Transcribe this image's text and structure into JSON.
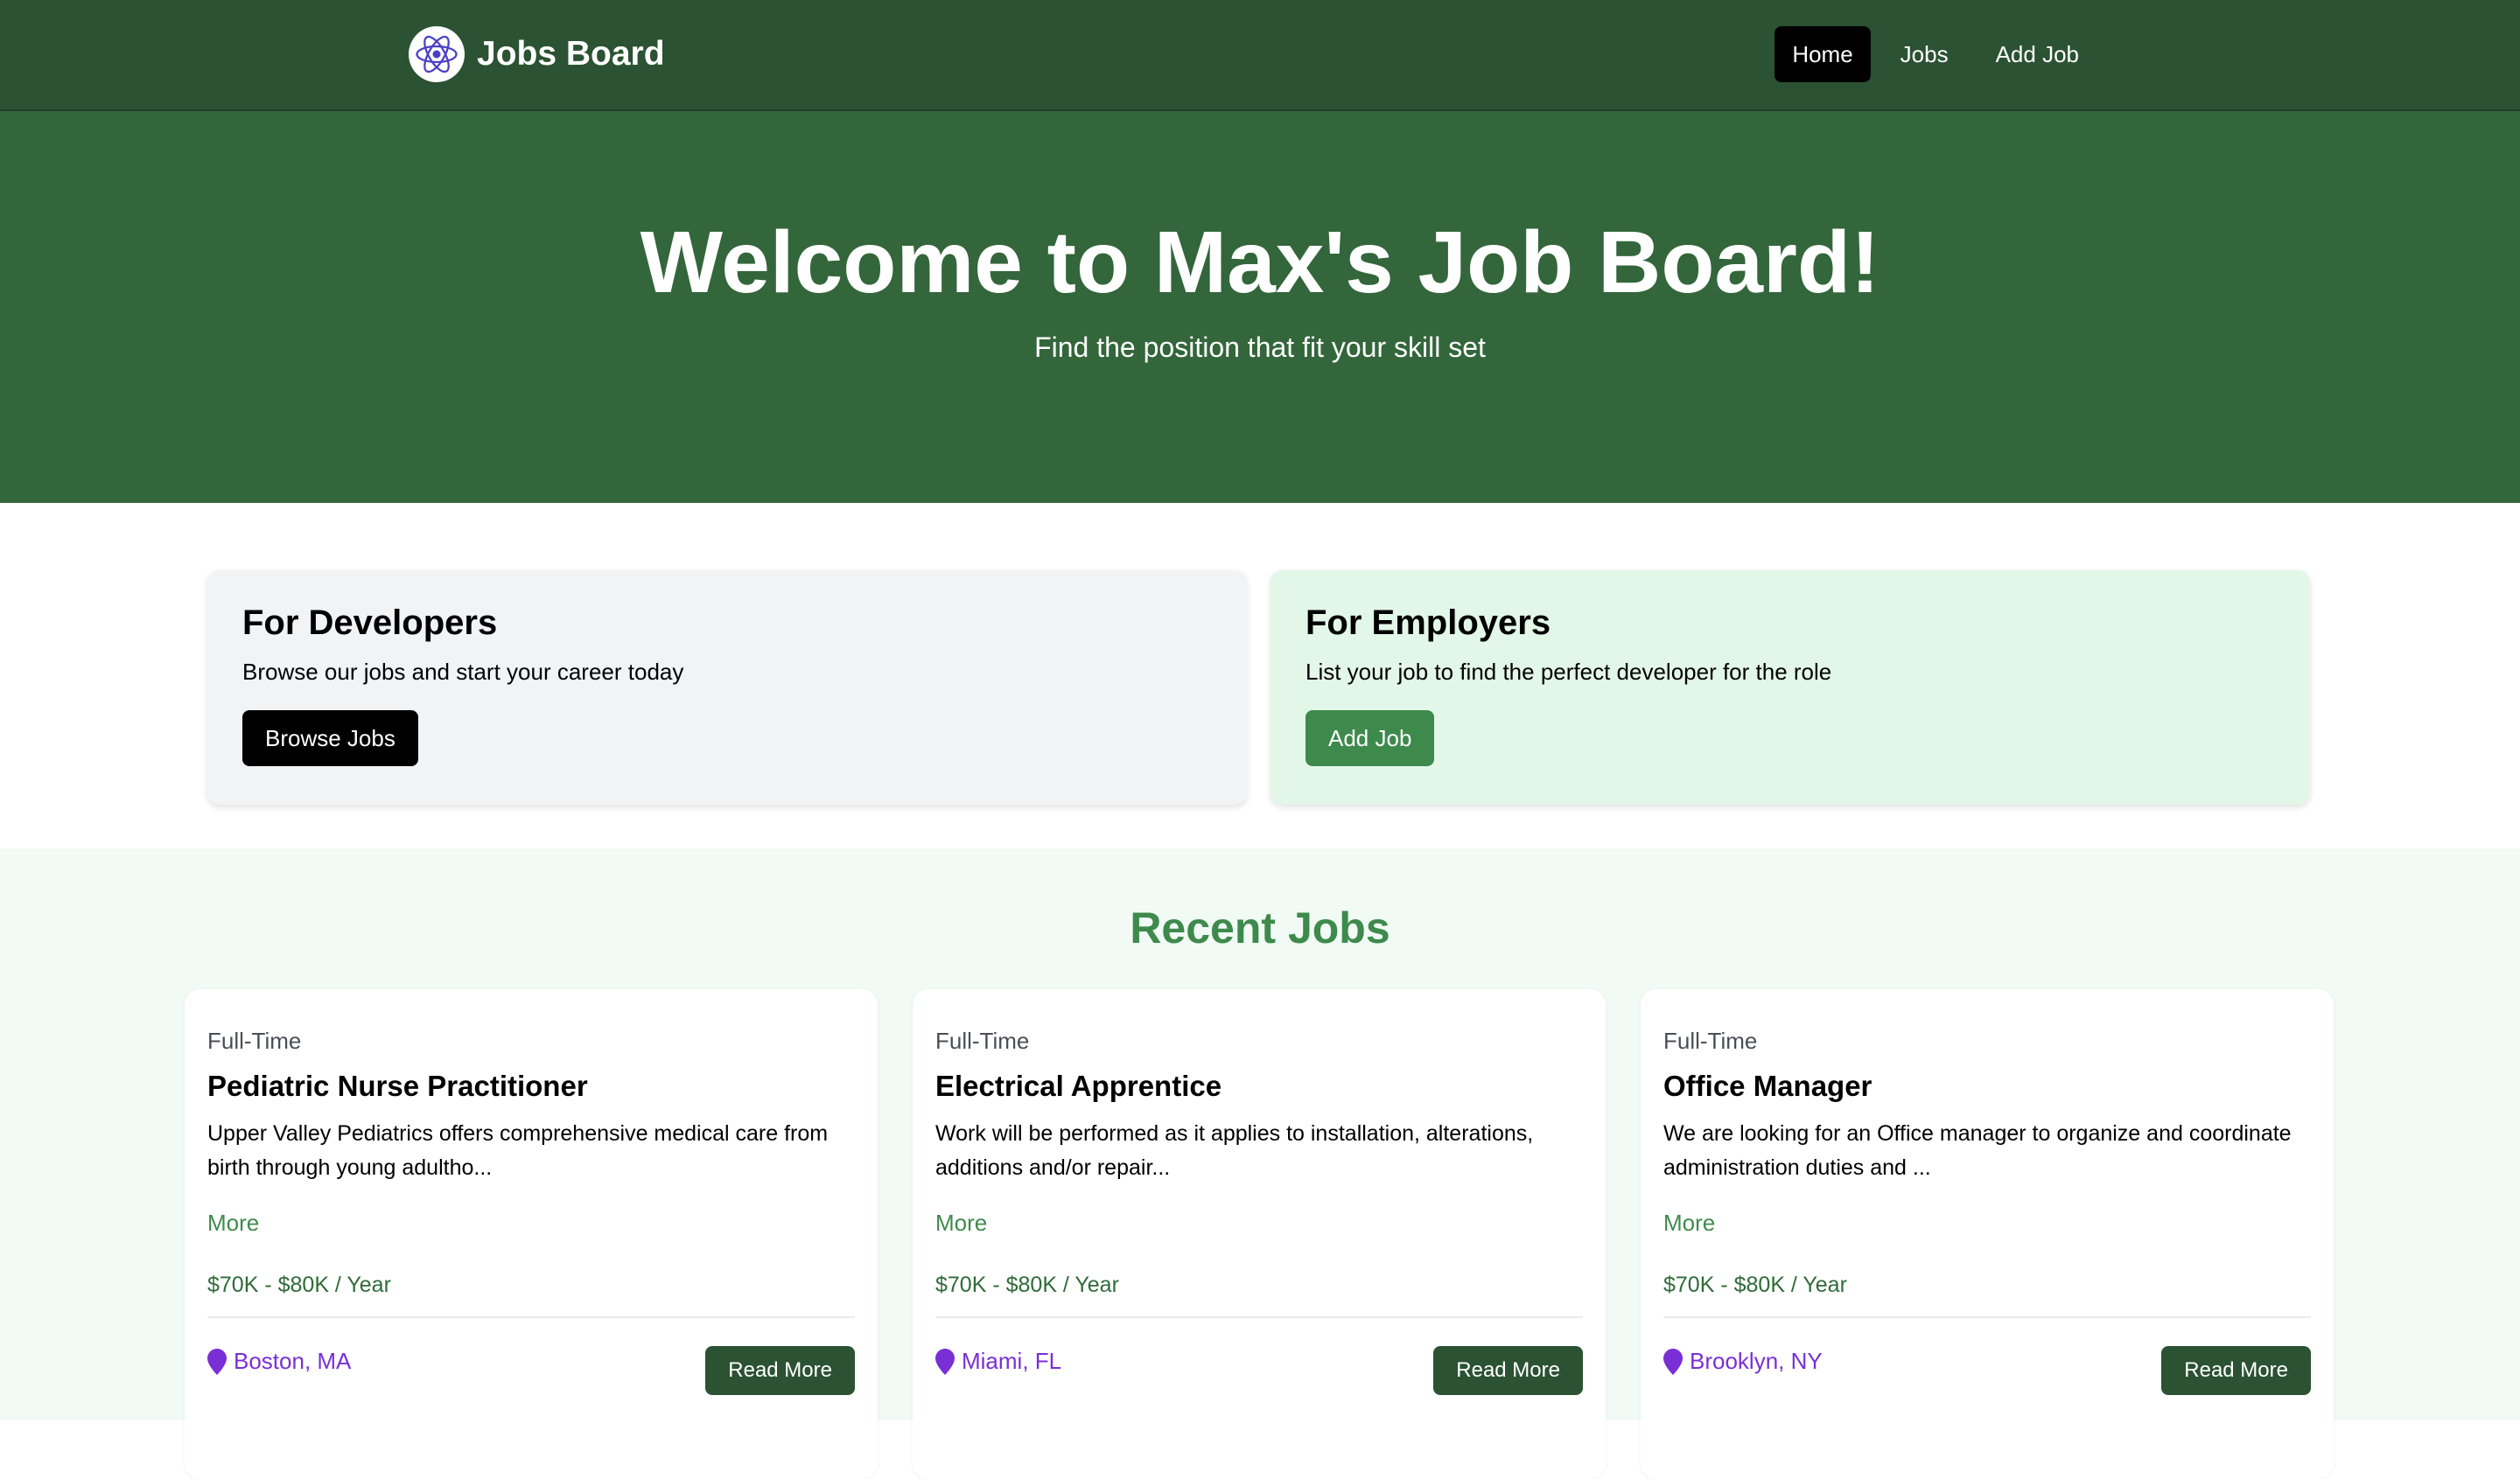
{
  "nav": {
    "brand": "Jobs Board",
    "links": [
      "Home",
      "Jobs",
      "Add Job"
    ]
  },
  "hero": {
    "title": "Welcome to Max's Job Board!",
    "subtitle": "Find the position that fit your skill set"
  },
  "developers": {
    "title": "For Developers",
    "text": "Browse our jobs and start your career today",
    "button": "Browse Jobs"
  },
  "employers": {
    "title": "For Employers",
    "text": "List your job to find the perfect developer for the role",
    "button": "Add Job"
  },
  "recent": {
    "heading": "Recent Jobs",
    "jobs": [
      {
        "type": "Full-Time",
        "title": "Pediatric Nurse Practitioner",
        "description": "Upper Valley Pediatrics offers comprehensive medical care from birth through young adultho...",
        "more": "More",
        "salary": "$70K - $80K / Year",
        "location": "Boston, MA",
        "button": "Read More"
      },
      {
        "type": "Full-Time",
        "title": "Electrical Apprentice",
        "description": "Work will be performed as it applies to installation, alterations, additions and/or repair...",
        "more": "More",
        "salary": "$70K - $80K / Year",
        "location": "Miami, FL",
        "button": "Read More"
      },
      {
        "type": "Full-Time",
        "title": "Office Manager",
        "description": "We are looking for an Office manager to organize and coordinate administration duties and ...",
        "more": "More",
        "salary": "$70K - $80K / Year",
        "location": "Brooklyn, NY",
        "button": "Read More"
      }
    ]
  },
  "colors": {
    "nav_bg": "#2b5233",
    "hero_bg": "#33663b",
    "accent_green": "#3e8a4c",
    "location_purple": "#7a2fd6"
  },
  "icons": {
    "logo": "react-atom-icon",
    "location": "map-pin-icon"
  }
}
